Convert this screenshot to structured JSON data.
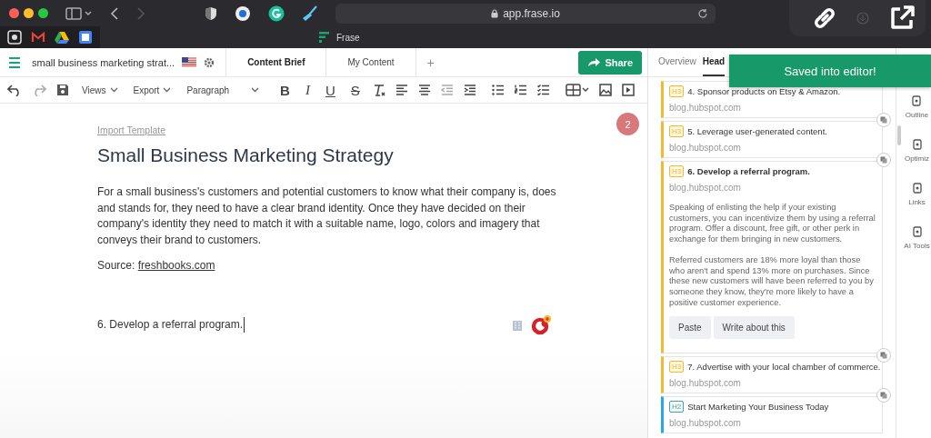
{
  "browser": {
    "url": "app.frase.io",
    "tab_title": "Frase"
  },
  "header": {
    "doc_title": "small business marketing strat...",
    "tabs": [
      {
        "label": "Content Brief",
        "selected": true
      },
      {
        "label": "My Content",
        "selected": false
      }
    ],
    "add_tab": "+",
    "share": "Share"
  },
  "toolbar": {
    "dropdowns": [
      "Views",
      "Export",
      "Paragraph"
    ],
    "formats": [
      {
        "label": "B",
        "kind": "bold"
      },
      {
        "label": "I",
        "kind": "italic"
      },
      {
        "label": "U",
        "kind": "underline"
      },
      {
        "label": "S",
        "kind": "strike"
      }
    ]
  },
  "editor": {
    "import_link": "Import Template",
    "title": "Small Business Marketing Strategy",
    "paragraph": "For a small business's customers and potential customers to know what their company is, does and stands for, they need to have a clear brand identity. Once they have decided on their company's identity they need to match it with a suitable name, logo, colors and imagery that conveys their brand to customers.",
    "source_label": "Source:",
    "source_link": "freshbooks.com",
    "current_line": "6. Develop a referral program.",
    "comment_count": "2"
  },
  "panel": {
    "tabs": [
      {
        "label": "Overview",
        "selected": false
      },
      {
        "label": "Head",
        "selected": true
      }
    ],
    "cards": [
      {
        "level": "H3",
        "title": "4. Sponsor products on Etsy & Amazon.",
        "source": "blog.hubspot.com",
        "expanded": false
      },
      {
        "level": "H3",
        "title": "5. Leverage user-generated content.",
        "source": "blog.hubspot.com",
        "expanded": false
      },
      {
        "level": "H3",
        "title": "6. Develop a referral program.",
        "source": "blog.hubspot.com",
        "expanded": true,
        "body": [
          "Speaking of enlisting the help if your existing customers, you can incentivize them by using a referral program. Offer a discount, free gift, or other perk in exchange for them bringing in new customers.",
          "Referred customers are 18% more loyal than those who aren't and spend 13% more on purchases. Since these new customers will have been referred to you by someone they know, they're more likely to have a positive customer experience."
        ],
        "buttons": [
          "Paste",
          "Write about this"
        ]
      },
      {
        "level": "H3",
        "title": "7. Advertise with your local chamber of commerce.",
        "source": "blog.hubspot.com",
        "expanded": false
      },
      {
        "level": "H2",
        "title": "Start Marketing Your Business Today",
        "source": "blog.hubspot.com",
        "expanded": false
      }
    ]
  },
  "side_tools": [
    "Outline",
    "Optimiz",
    "Links",
    "AI Tools"
  ],
  "toast": "Saved into editor!"
}
